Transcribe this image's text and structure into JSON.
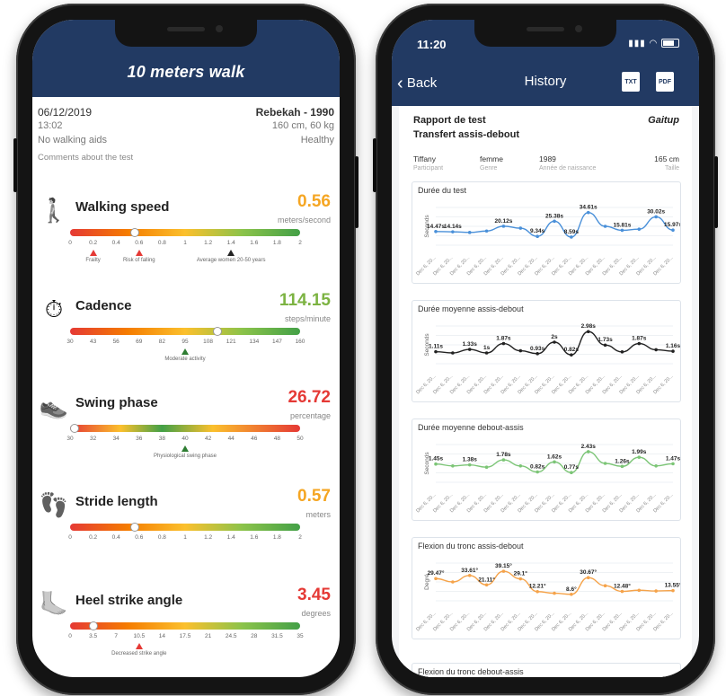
{
  "left_app": {
    "title": "10 meters walk",
    "date": "06/12/2019",
    "time": "13:02",
    "aids": "No walking aids",
    "comments": "Comments about the test",
    "patient": "Rebekah - 1990",
    "measures": "160 cm, 60 kg",
    "health": "Healthy",
    "sections": [
      {
        "label": "Walking speed",
        "value": "0.56",
        "unit": "meters/second",
        "value_color": "#f5a623",
        "ticks": [
          "0",
          "0.2",
          "0.4",
          "0.6",
          "0.8",
          "1",
          "1.2",
          "1.4",
          "1.6",
          "1.8",
          "2"
        ],
        "indicator": 0.28,
        "markers": [
          {
            "label": "Frailty",
            "pos": 0.1,
            "color": "#e53935"
          },
          {
            "label": "Risk of falling",
            "pos": 0.3,
            "color": "#e53935"
          },
          {
            "label": "Average women 20-50 years",
            "pos": 0.7,
            "color": "#222222"
          }
        ]
      },
      {
        "label": "Cadence",
        "value": "114.15",
        "unit": "steps/minute",
        "value_color": "#7cb342",
        "ticks": [
          "30",
          "43",
          "56",
          "69",
          "82",
          "95",
          "108",
          "121",
          "134",
          "147",
          "160"
        ],
        "indicator": 0.64,
        "markers": [
          {
            "label": "Moderate activity",
            "pos": 0.5,
            "color": "#2e7d32"
          }
        ]
      },
      {
        "label": "Swing phase",
        "value": "26.72",
        "unit": "percentage",
        "value_color": "#e53935",
        "ticks": [
          "30",
          "32",
          "34",
          "36",
          "38",
          "40",
          "42",
          "44",
          "46",
          "48",
          "50"
        ],
        "indicator": 0.02,
        "markers": [
          {
            "label": "Physiological swing phase",
            "pos": 0.5,
            "color": "#2e7d32"
          }
        ]
      },
      {
        "label": "Stride length",
        "value": "0.57",
        "unit": "meters",
        "value_color": "#f5a623",
        "ticks": [
          "0",
          "0.2",
          "0.4",
          "0.6",
          "0.8",
          "1",
          "1.2",
          "1.4",
          "1.6",
          "1.8",
          "2"
        ],
        "indicator": 0.28,
        "markers": []
      },
      {
        "label": "Heel strike angle",
        "value": "3.45",
        "unit": "degrees",
        "value_color": "#e53935",
        "ticks": [
          "0",
          "3.5",
          "7",
          "10.5",
          "14",
          "17.5",
          "21",
          "24.5",
          "28",
          "31.5",
          "35"
        ],
        "indicator": 0.1,
        "markers": [
          {
            "label": "Decreased strike angle",
            "pos": 0.3,
            "color": "#e53935"
          }
        ]
      }
    ]
  },
  "right_app": {
    "status_time": "11:20",
    "back_label": "Back",
    "title": "History",
    "txt_label": "TXT",
    "pdf_label": "PDF",
    "report_title_1": "Rapport de test",
    "report_title_2": "Transfert assis-debout",
    "brand": "Gaitup",
    "participant": {
      "name": "Tiffany",
      "gender": "femme",
      "birth_year": "1989",
      "height": "165 cm",
      "name_label": "Participant",
      "gender_label": "Genre",
      "birth_label": "Année de naissance",
      "height_label": "Taille"
    },
    "next_card_title": "Flexion du tronc debout-assis"
  },
  "chart_data": [
    {
      "type": "line",
      "title": "Durée du test",
      "ylabel": "Seconds",
      "xtick": "Dec 6, 20...",
      "color": "#4a90d9",
      "values": [
        14.47,
        14.14,
        13.5,
        15,
        20.12,
        18,
        9.34,
        25.38,
        8.59,
        34.61,
        20,
        15.81,
        17,
        30.02,
        15.97
      ],
      "labels": [
        "14.47s",
        "14.14s",
        "",
        "",
        "20.12s",
        "",
        "9.34s",
        "25.38s",
        "8.59s",
        "34.61s",
        "",
        "15.81s",
        "",
        "30.02s",
        "15.97s"
      ],
      "ylim": [
        0,
        40
      ]
    },
    {
      "type": "line",
      "title": "Durée moyenne assis-debout",
      "ylabel": "Seconds",
      "xtick": "Dec 6, 20...",
      "color": "#222222",
      "values": [
        1.11,
        1.0,
        1.33,
        1.0,
        1.87,
        1.2,
        0.93,
        2.0,
        0.82,
        2.98,
        1.73,
        1.1,
        1.87,
        1.3,
        1.16
      ],
      "labels": [
        "1.11s",
        "",
        "1.33s",
        "1s",
        "1.87s",
        "",
        "0.93s",
        "2s",
        "0.82s",
        "2.98s",
        "1.73s",
        "",
        "1.87s",
        "",
        "1.16s"
      ],
      "ylim": [
        0,
        3.5
      ]
    },
    {
      "type": "line",
      "title": "Durée moyenne debout-assis",
      "ylabel": "Seconds",
      "xtick": "Dec 6, 20...",
      "color": "#7cc576",
      "values": [
        1.45,
        1.3,
        1.38,
        1.2,
        1.78,
        1.3,
        0.82,
        1.62,
        0.77,
        2.43,
        1.5,
        1.26,
        1.99,
        1.3,
        1.47
      ],
      "labels": [
        "1.45s",
        "",
        "1.38s",
        "",
        "1.78s",
        "",
        "0.82s",
        "1.62s",
        "0.77s",
        "2.43s",
        "",
        "1.26s",
        "1.99s",
        "",
        "1.47s"
      ],
      "ylim": [
        0,
        3
      ]
    },
    {
      "type": "line",
      "title": "Flexion du tronc assis-debout",
      "ylabel": "Degré",
      "xtick": "Dec 6, 20...",
      "color": "#f5a34a",
      "values": [
        29.47,
        25,
        33.61,
        21.11,
        39.15,
        29.1,
        12.21,
        10,
        8.6,
        30.67,
        20,
        12.48,
        14,
        13,
        13.55
      ],
      "labels": [
        "29.47°",
        "",
        "33.61°",
        "21.11°",
        "39.15°",
        "29.1°",
        "12.21°",
        "",
        "8.6°",
        "30.67°",
        "",
        "12.48°",
        "",
        "",
        "13.55°"
      ],
      "ylim": [
        0,
        50
      ]
    }
  ]
}
